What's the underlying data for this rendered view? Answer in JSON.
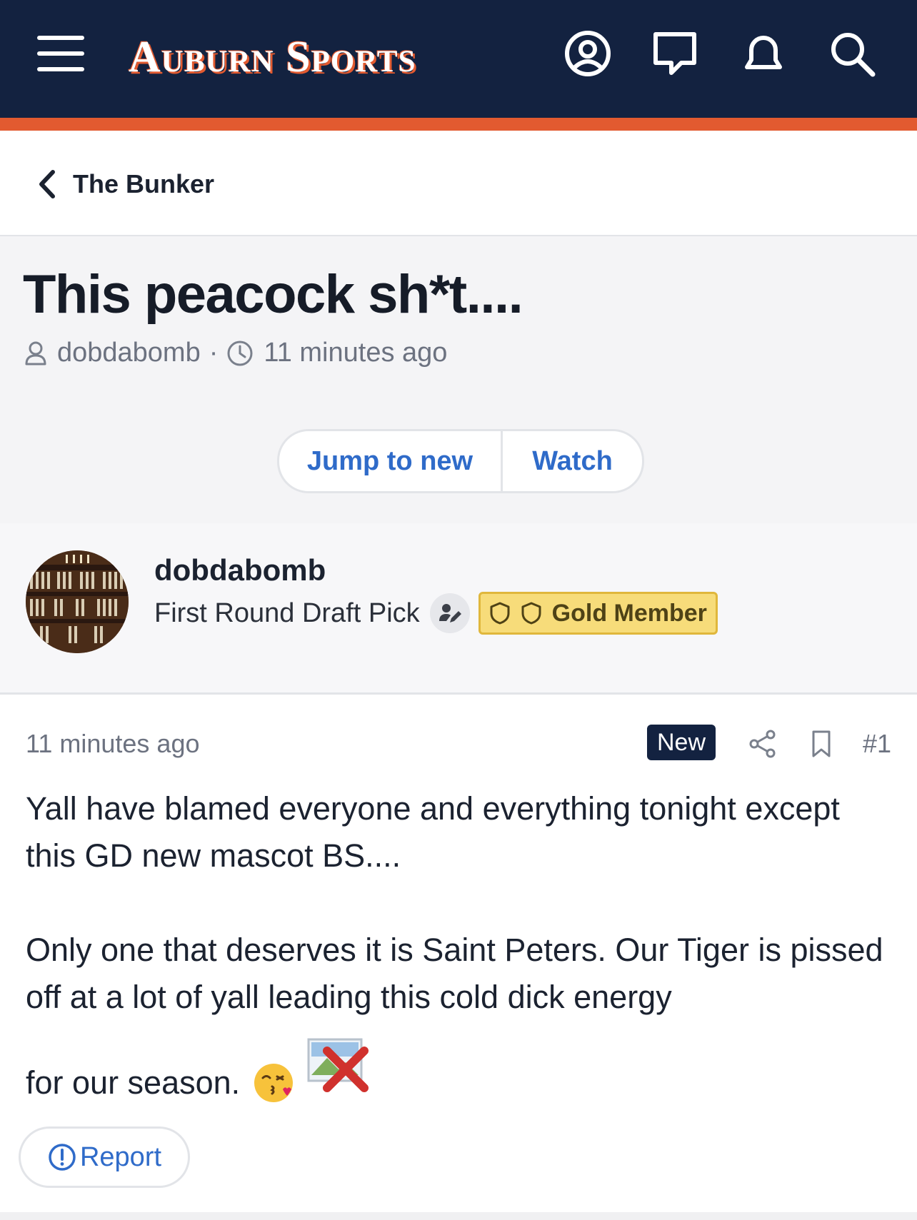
{
  "header": {
    "logo_text": "Auburn Sports",
    "icons": [
      "menu-icon",
      "account-icon",
      "chat-icon",
      "bell-icon",
      "search-icon"
    ],
    "colors": {
      "navy": "#132240",
      "orange": "#e25a30"
    }
  },
  "breadcrumb": {
    "label": "The Bunker"
  },
  "thread": {
    "title": "This peacock sh*t....",
    "author": "dobdabomb",
    "separator": "·",
    "time": "11 minutes ago",
    "buttons": {
      "jump": "Jump to new",
      "watch": "Watch"
    }
  },
  "author": {
    "name": "dobdabomb",
    "title": "First Round Draft Pick",
    "badge": "Gold Member"
  },
  "post": {
    "time": "11 minutes ago",
    "new_label": "New",
    "number": "#1",
    "line1": "Yall have blamed everyone and everything tonight except this GD new mascot BS....",
    "line2": "Only one that deserves it is Saint Peters. Our Tiger is pissed off at a lot of yall leading this cold dick energy",
    "line3": "for our season.",
    "report_label": "Report"
  }
}
